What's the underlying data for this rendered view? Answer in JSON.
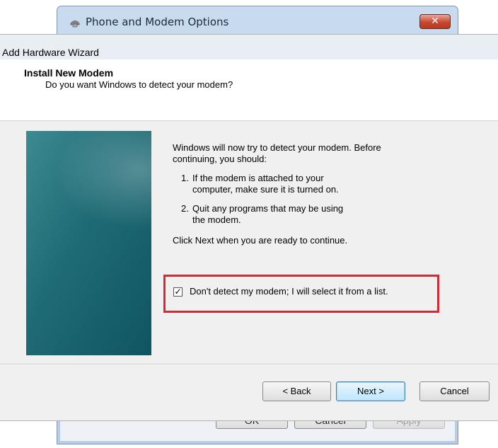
{
  "back_window": {
    "title": "Phone and Modem Options",
    "close_label": "✕",
    "buttons": {
      "ok": "OK",
      "cancel": "Cancel",
      "apply": "Apply"
    }
  },
  "wizard": {
    "title": "Add Hardware Wizard",
    "header_title": "Install New Modem",
    "header_subtitle": "Do you want Windows to detect your modem?",
    "intro_line1": "Windows will now try to detect your modem.  Before",
    "intro_line2": "continuing, you should:",
    "step1_num": "1.",
    "step1_line1": "If the modem is attached to your",
    "step1_line2": "computer, make sure it is turned on.",
    "step2_num": "2.",
    "step2_line1": "Quit any programs that may be using",
    "step2_line2": "the modem.",
    "next_hint": "Click Next when you are ready to continue.",
    "checkbox_label": "Don't detect my modem; I will select it from a list.",
    "checkbox_checked": true,
    "buttons": {
      "back": "< Back",
      "next": "Next >",
      "cancel": "Cancel"
    },
    "highlight_color": "#d22b35"
  }
}
